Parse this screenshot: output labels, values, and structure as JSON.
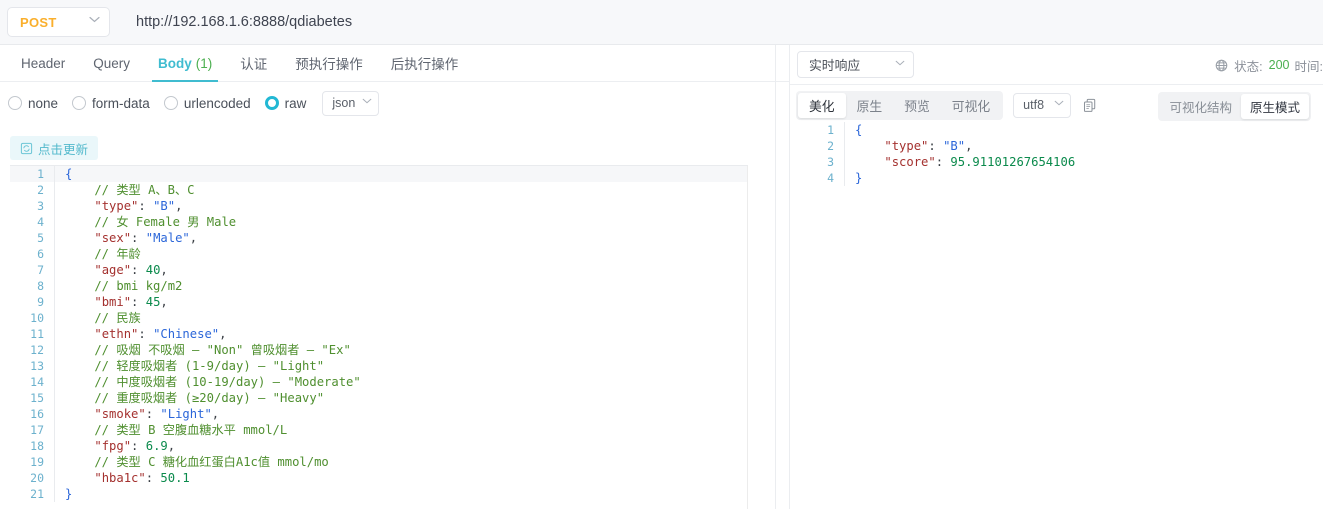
{
  "urlbar": {
    "method": "POST",
    "method_caret": "chevron-down",
    "url": "http://192.168.1.6:8888/qdiabetes"
  },
  "request_tabs": [
    {
      "label": "Header",
      "active": false
    },
    {
      "label": "Query",
      "active": false
    },
    {
      "label": "Body",
      "count": "(1)",
      "active": true
    },
    {
      "label": "认证",
      "active": false
    },
    {
      "label": "预执行操作",
      "active": false
    },
    {
      "label": "后执行操作",
      "active": false
    }
  ],
  "body_types": [
    {
      "label": "none",
      "checked": false
    },
    {
      "label": "form-data",
      "checked": false
    },
    {
      "label": "urlencoded",
      "checked": false
    },
    {
      "label": "raw",
      "checked": true
    }
  ],
  "content_type_select": "json",
  "mode_toggle": [
    {
      "label": "可视化结构",
      "active": false
    },
    {
      "label": "原生模式",
      "active": true
    }
  ],
  "update_button": "点击更新",
  "request_code": [
    {
      "n": "1",
      "tokens": [
        {
          "t": "{",
          "c": "k-brace"
        }
      ]
    },
    {
      "n": "2",
      "tokens": [
        {
          "t": "    // 类型 A、B、C",
          "c": "k-com"
        }
      ]
    },
    {
      "n": "3",
      "tokens": [
        {
          "t": "    ",
          "c": ""
        },
        {
          "t": "\"type\"",
          "c": "k-key"
        },
        {
          "t": ": ",
          "c": "k-punc"
        },
        {
          "t": "\"B\"",
          "c": "k-str"
        },
        {
          "t": ",",
          "c": "k-punc"
        }
      ]
    },
    {
      "n": "4",
      "tokens": [
        {
          "t": "    // 女 Female 男 Male",
          "c": "k-com"
        }
      ]
    },
    {
      "n": "5",
      "tokens": [
        {
          "t": "    ",
          "c": ""
        },
        {
          "t": "\"sex\"",
          "c": "k-key"
        },
        {
          "t": ": ",
          "c": "k-punc"
        },
        {
          "t": "\"Male\"",
          "c": "k-str"
        },
        {
          "t": ",",
          "c": "k-punc"
        }
      ]
    },
    {
      "n": "6",
      "tokens": [
        {
          "t": "    // 年龄",
          "c": "k-com"
        }
      ]
    },
    {
      "n": "7",
      "tokens": [
        {
          "t": "    ",
          "c": ""
        },
        {
          "t": "\"age\"",
          "c": "k-key"
        },
        {
          "t": ": ",
          "c": "k-punc"
        },
        {
          "t": "40",
          "c": "k-num"
        },
        {
          "t": ",",
          "c": "k-punc"
        }
      ]
    },
    {
      "n": "8",
      "tokens": [
        {
          "t": "    // bmi kg/m2",
          "c": "k-com"
        }
      ]
    },
    {
      "n": "9",
      "tokens": [
        {
          "t": "    ",
          "c": ""
        },
        {
          "t": "\"bmi\"",
          "c": "k-key"
        },
        {
          "t": ": ",
          "c": "k-punc"
        },
        {
          "t": "45",
          "c": "k-num"
        },
        {
          "t": ",",
          "c": "k-punc"
        }
      ]
    },
    {
      "n": "10",
      "tokens": [
        {
          "t": "    // 民族",
          "c": "k-com"
        }
      ]
    },
    {
      "n": "11",
      "tokens": [
        {
          "t": "    ",
          "c": ""
        },
        {
          "t": "\"ethn\"",
          "c": "k-key"
        },
        {
          "t": ": ",
          "c": "k-punc"
        },
        {
          "t": "\"Chinese\"",
          "c": "k-str"
        },
        {
          "t": ",",
          "c": "k-punc"
        }
      ]
    },
    {
      "n": "12",
      "tokens": [
        {
          "t": "    // 吸烟 不吸烟 — \"Non\" 曾吸烟者 — \"Ex\"",
          "c": "k-com"
        }
      ]
    },
    {
      "n": "13",
      "tokens": [
        {
          "t": "    // 轻度吸烟者 (1-9/day) — \"Light\"",
          "c": "k-com"
        }
      ]
    },
    {
      "n": "14",
      "tokens": [
        {
          "t": "    // 中度吸烟者 (10-19/day) — \"Moderate\"",
          "c": "k-com"
        }
      ]
    },
    {
      "n": "15",
      "tokens": [
        {
          "t": "    // 重度吸烟者 (≥20/day) — \"Heavy\"",
          "c": "k-com"
        }
      ]
    },
    {
      "n": "16",
      "tokens": [
        {
          "t": "    ",
          "c": ""
        },
        {
          "t": "\"smoke\"",
          "c": "k-key"
        },
        {
          "t": ": ",
          "c": "k-punc"
        },
        {
          "t": "\"Light\"",
          "c": "k-str"
        },
        {
          "t": ",",
          "c": "k-punc"
        }
      ]
    },
    {
      "n": "17",
      "tokens": [
        {
          "t": "    // 类型 B 空腹血糖水平 mmol/L",
          "c": "k-com"
        }
      ]
    },
    {
      "n": "18",
      "tokens": [
        {
          "t": "    ",
          "c": ""
        },
        {
          "t": "\"fpg\"",
          "c": "k-key"
        },
        {
          "t": ": ",
          "c": "k-punc"
        },
        {
          "t": "6.9",
          "c": "k-num"
        },
        {
          "t": ",",
          "c": "k-punc"
        }
      ]
    },
    {
      "n": "19",
      "tokens": [
        {
          "t": "    // 类型 C 糖化血红蛋白A1c值 mmol/mo",
          "c": "k-com"
        }
      ]
    },
    {
      "n": "20",
      "tokens": [
        {
          "t": "    ",
          "c": ""
        },
        {
          "t": "\"hba1c\"",
          "c": "k-key"
        },
        {
          "t": ": ",
          "c": "k-punc"
        },
        {
          "t": "50.1",
          "c": "k-num"
        }
      ]
    },
    {
      "n": "21",
      "tokens": [
        {
          "t": "}",
          "c": "k-brace"
        }
      ]
    }
  ],
  "response": {
    "source_select": "实时响应",
    "globe_icon": "globe-icon",
    "status_label": "状态:",
    "status_code": "200",
    "time_label": "时间:",
    "toolbar": [
      {
        "label": "美化",
        "active": true
      },
      {
        "label": "原生",
        "active": false
      },
      {
        "label": "预览",
        "active": false
      },
      {
        "label": "可视化",
        "active": false
      }
    ],
    "encoding_select": "utf8",
    "copy_icon": "copy-icon",
    "code": [
      {
        "n": "1",
        "tokens": [
          {
            "t": "{",
            "c": "k-brace"
          }
        ]
      },
      {
        "n": "2",
        "tokens": [
          {
            "t": "    ",
            "c": ""
          },
          {
            "t": "\"type\"",
            "c": "k-key"
          },
          {
            "t": ": ",
            "c": "k-punc"
          },
          {
            "t": "\"B\"",
            "c": "k-str"
          },
          {
            "t": ",",
            "c": "k-punc"
          }
        ]
      },
      {
        "n": "3",
        "tokens": [
          {
            "t": "    ",
            "c": ""
          },
          {
            "t": "\"score\"",
            "c": "k-key"
          },
          {
            "t": ": ",
            "c": "k-punc"
          },
          {
            "t": "95.91101267654106",
            "c": "k-num"
          }
        ]
      },
      {
        "n": "4",
        "tokens": [
          {
            "t": "}",
            "c": "k-brace"
          }
        ]
      }
    ]
  }
}
